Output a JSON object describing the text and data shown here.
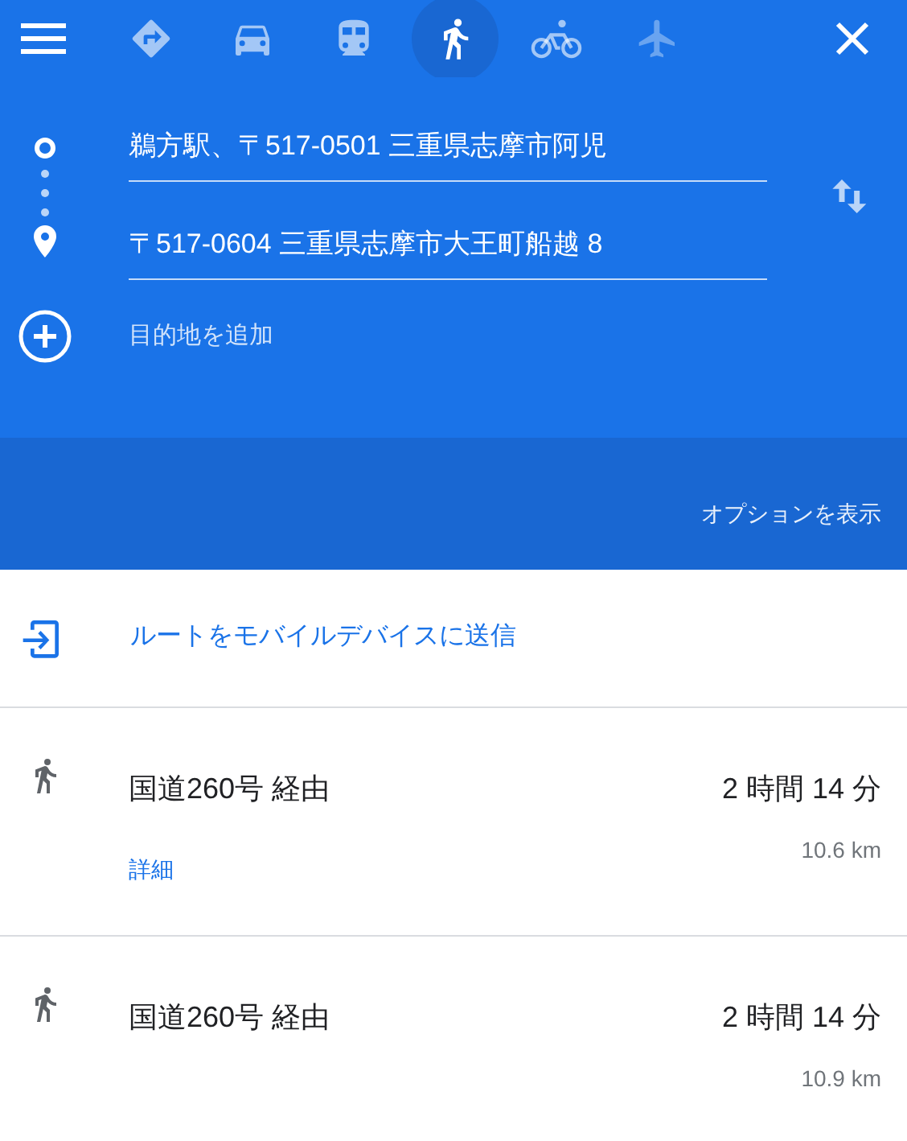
{
  "travel_modes": [
    {
      "kind": "best",
      "selected": false,
      "disabled": false
    },
    {
      "kind": "car",
      "selected": false,
      "disabled": false
    },
    {
      "kind": "transit",
      "selected": false,
      "disabled": false
    },
    {
      "kind": "walk",
      "selected": true,
      "disabled": false
    },
    {
      "kind": "bike",
      "selected": false,
      "disabled": false
    },
    {
      "kind": "plane",
      "selected": false,
      "disabled": true
    }
  ],
  "waypoints": [
    {
      "kind": "origin",
      "value": "鵜方駅、〒517-0501 三重県志摩市阿児"
    },
    {
      "kind": "destination",
      "value": "〒517-0604 三重県志摩市大王町船越 8"
    }
  ],
  "add_destination": "目的地を追加",
  "options_link": "オプションを表示",
  "send_to_device": "ルートをモバイルデバイスに送信",
  "routes": [
    {
      "title": "国道260号 経由",
      "duration": "2 時間 14 分",
      "distance": "10.6 km",
      "details_link": "詳細"
    },
    {
      "title": "国道260号 経由",
      "duration": "2 時間 14 分",
      "distance": "10.9 km"
    }
  ]
}
